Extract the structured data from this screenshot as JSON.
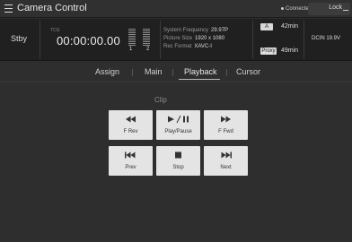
{
  "header": {
    "title": "Camera Control",
    "connection_status": "Connected",
    "lock_label": "Lock"
  },
  "status": {
    "mode": "Stby",
    "tc_label": "TCG",
    "timecode": "00:00:00.00",
    "audio_channels": [
      "1",
      "2"
    ],
    "system_frequency_label": "System Frequency",
    "system_frequency_value": "29.97P",
    "picture_size_label": "Picture Size",
    "picture_size_value": "1920 x 1080",
    "rec_format_label": "Rec Format",
    "rec_format_value": "XAVC-I",
    "slot_a_label": "A",
    "slot_a_time": "42min",
    "proxy_label": "Proxy",
    "proxy_time": "49min",
    "power": "DCIN 19.9V"
  },
  "tabs": [
    {
      "label": "Assign",
      "active": false
    },
    {
      "label": "Main",
      "active": false
    },
    {
      "label": "Playback",
      "active": true
    },
    {
      "label": "Cursor",
      "active": false
    }
  ],
  "clip": {
    "section_label": "Clip",
    "buttons": [
      {
        "label": "F Rev",
        "icon": "fast-rewind-icon"
      },
      {
        "label": "Play/Pause",
        "icon": "play-pause-icon"
      },
      {
        "label": "F Fwd",
        "icon": "fast-forward-icon"
      },
      {
        "label": "Prev",
        "icon": "previous-icon"
      },
      {
        "label": "Stop",
        "icon": "stop-icon"
      },
      {
        "label": "Next",
        "icon": "next-icon"
      }
    ]
  },
  "colors": {
    "background": "#2e2e2e",
    "status_panel": "#202020",
    "button_face": "#e4e4e4",
    "button_icon": "#333333"
  }
}
